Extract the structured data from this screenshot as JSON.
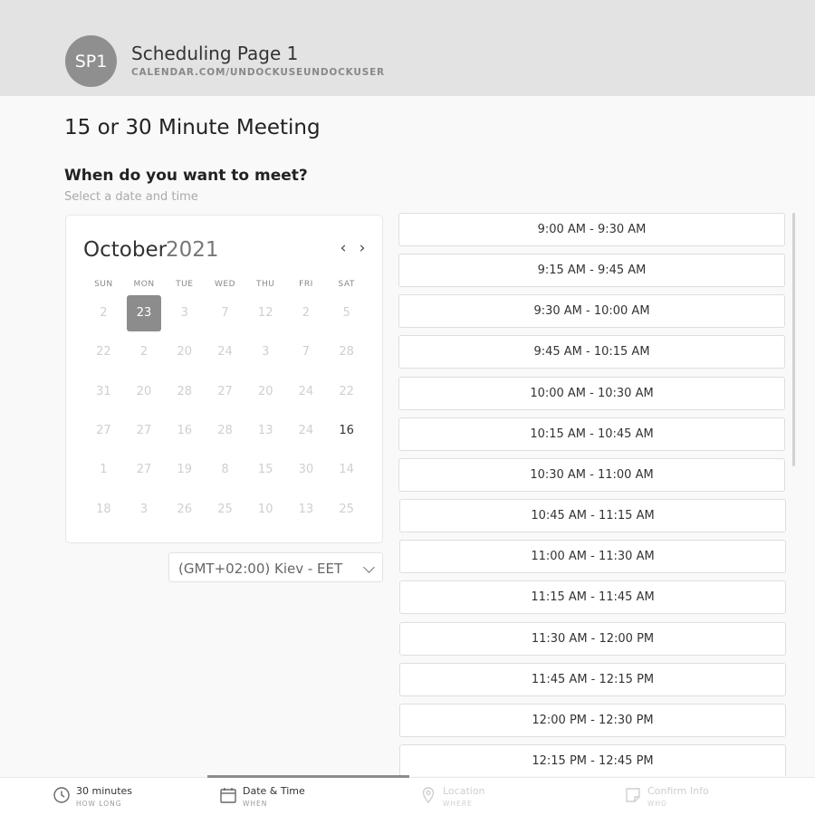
{
  "header": {
    "avatar_initials": "SP1",
    "page_name": "Scheduling Page 1",
    "page_url": "CALENDAR.COM/UNDOCKUSEUNDOCKUSER"
  },
  "meeting": {
    "title": "15 or 30 Minute Meeting",
    "question": "When do you want to meet?",
    "hint": "Select a date and time"
  },
  "calendar": {
    "month": "October",
    "year": "2021",
    "weekdays": [
      "SUN",
      "MON",
      "TUE",
      "WED",
      "THU",
      "FRI",
      "SAT"
    ],
    "days": [
      "2",
      "23",
      "3",
      "7",
      "12",
      "2",
      "5",
      "22",
      "2",
      "20",
      "24",
      "3",
      "7",
      "28",
      "31",
      "20",
      "28",
      "27",
      "20",
      "24",
      "22",
      "27",
      "27",
      "16",
      "28",
      "13",
      "24",
      "16",
      "1",
      "27",
      "19",
      "8",
      "15",
      "30",
      "14",
      "18",
      "3",
      "26",
      "25",
      "10",
      "13",
      "25"
    ],
    "selected_index": 1,
    "active_indices": [
      27
    ]
  },
  "timezone": {
    "label": "(GMT+02:00) Kiev - EET"
  },
  "slots": [
    "9:00 AM - 9:30 AM",
    "9:15 AM - 9:45 AM",
    "9:30 AM - 10:00 AM",
    "9:45 AM - 10:15 AM",
    "10:00 AM - 10:30 AM",
    "10:15 AM - 10:45 AM",
    "10:30 AM - 11:00 AM",
    "10:45 AM - 11:15 AM",
    "11:00 AM - 11:30 AM",
    "11:15 AM - 11:45 AM",
    "11:30 AM - 12:00 PM",
    "11:45 AM - 12:15 PM",
    "12:00 PM - 12:30 PM",
    "12:15 PM - 12:45 PM"
  ],
  "steps": [
    {
      "label": "30 minutes",
      "sub": "HOW LONG",
      "icon": "clock-icon",
      "state": "done"
    },
    {
      "label": "Date & Time",
      "sub": "WHEN",
      "icon": "calendar-icon",
      "state": "current"
    },
    {
      "label": "Location",
      "sub": "WHERE",
      "icon": "location-pin-icon",
      "state": "upcoming"
    },
    {
      "label": "Confirm Info",
      "sub": "WHO",
      "icon": "note-icon",
      "state": "upcoming"
    }
  ]
}
